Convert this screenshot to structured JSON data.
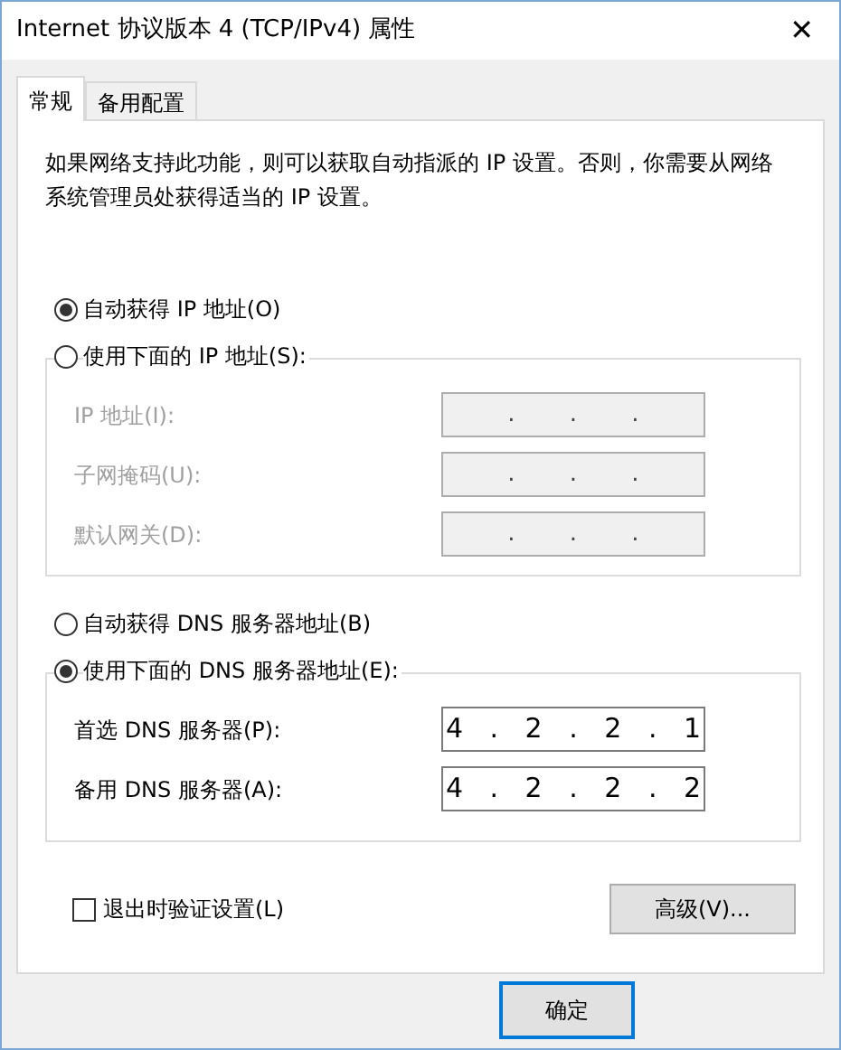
{
  "window": {
    "title": "Internet 协议版本 4 (TCP/IPv4) 属性",
    "close": "✕"
  },
  "tabs": [
    {
      "label": "常规",
      "selected": true
    },
    {
      "label": "备用配置",
      "selected": false
    }
  ],
  "description": "如果网络支持此功能，则可以获取自动指派的 IP 设置。否则，你需要从网络系统管理员处获得适当的 IP 设置。",
  "ip_options": [
    {
      "label": "自动获得 IP 地址(O)",
      "selected": true
    },
    {
      "label": "使用下面的 IP 地址(S):",
      "selected": false
    }
  ],
  "ip_fields": [
    {
      "label": "IP 地址(I):",
      "value": ". . .",
      "disabled": true
    },
    {
      "label": "子网掩码(U):",
      "value": ". . .",
      "disabled": true
    },
    {
      "label": "默认网关(D):",
      "value": ". . .",
      "disabled": true
    }
  ],
  "dns_options": [
    {
      "label": "自动获得 DNS 服务器地址(B)",
      "selected": false
    },
    {
      "label": "使用下面的 DNS 服务器地址(E):",
      "selected": true
    }
  ],
  "dns_fields": [
    {
      "label": "首选 DNS 服务器(P):",
      "value": "4 . 2 . 2 . 1",
      "disabled": false
    },
    {
      "label": "备用 DNS 服务器(A):",
      "value": "4 . 2 . 2 . 2",
      "disabled": false
    }
  ],
  "validate_on_exit": {
    "label": "退出时验证设置(L)",
    "checked": false
  },
  "advanced_button": "高级(V)...",
  "buttons": [
    "确定"
  ]
}
